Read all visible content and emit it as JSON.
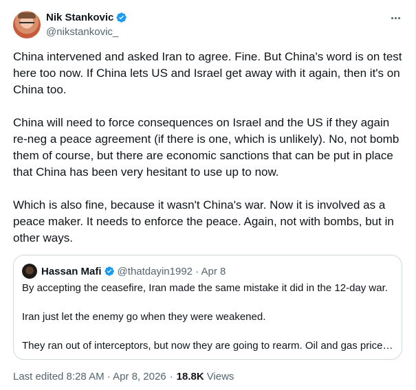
{
  "author": {
    "name": "Nik Stankovic",
    "handle": "@nikstankovic_"
  },
  "tweet": {
    "paragraphs": [
      "China intervened and asked Iran to agree. Fine. But China's word is on test here too now. If China lets US and Israel get away with it again, then it's on China too.",
      "China will need to force consequences on Israel and the US if they again re-neg a peace agreement (if there is one, which is unlikely). No, not bomb them of course, but there are economic sanctions that can be put in place that China has been very hesitant to use up to now.",
      "Which is also fine, because it wasn't China's war. Now it is involved as a peace maker. It needs to enforce the peace. Again, not with bombs, but in other ways."
    ]
  },
  "quote": {
    "name": "Hassan Mafi",
    "handle_date": "@thatdayin1992 · Apr 8",
    "paragraphs": [
      "By accepting the ceasefire, Iran made the same mistake it did in the 12-day war.",
      "Iran just let the enemy go when they were weakened.",
      "They ran out of interceptors, but now they are going to rearm. Oil and gas price…"
    ]
  },
  "footer": {
    "edited": "Last edited 8:28 AM · Apr 8, 2026",
    "separator": "·",
    "views_count": "18.8K",
    "views_label": "Views"
  },
  "colors": {
    "verified": "#1d9bf0",
    "text_primary": "#0f1419",
    "text_secondary": "#536471",
    "border": "#cfd9de"
  },
  "icons": {
    "verified": "verified-badge-icon",
    "more": "more-horizontal-icon"
  }
}
